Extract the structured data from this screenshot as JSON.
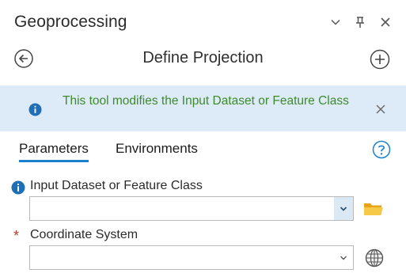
{
  "window": {
    "title": "Geoprocessing",
    "icons": [
      "chevron-down-icon",
      "pin-icon",
      "close-icon"
    ]
  },
  "tool": {
    "name": "Define Projection",
    "back_icon": "back-arrow-icon",
    "add_icon": "add-circle-icon"
  },
  "banner": {
    "text": "This tool modifies the Input Dataset or Feature Class",
    "text_color": "#3f8a2d",
    "background": "#dcebf7",
    "icon": "info-icon",
    "close_icon": "close-icon"
  },
  "tabs": {
    "parameters": "Parameters",
    "environments": "Environments",
    "active": "parameters",
    "help_icon": "help-icon",
    "accent": "#1a80d0"
  },
  "params": [
    {
      "label": "Input Dataset or Feature Class",
      "value": "",
      "marker": "info-icon",
      "action_icon": "folder-icon"
    },
    {
      "label": "Coordinate System",
      "value": "",
      "marker": "*",
      "marker_color": "#c0392b",
      "action_icon": "globe-icon"
    }
  ]
}
